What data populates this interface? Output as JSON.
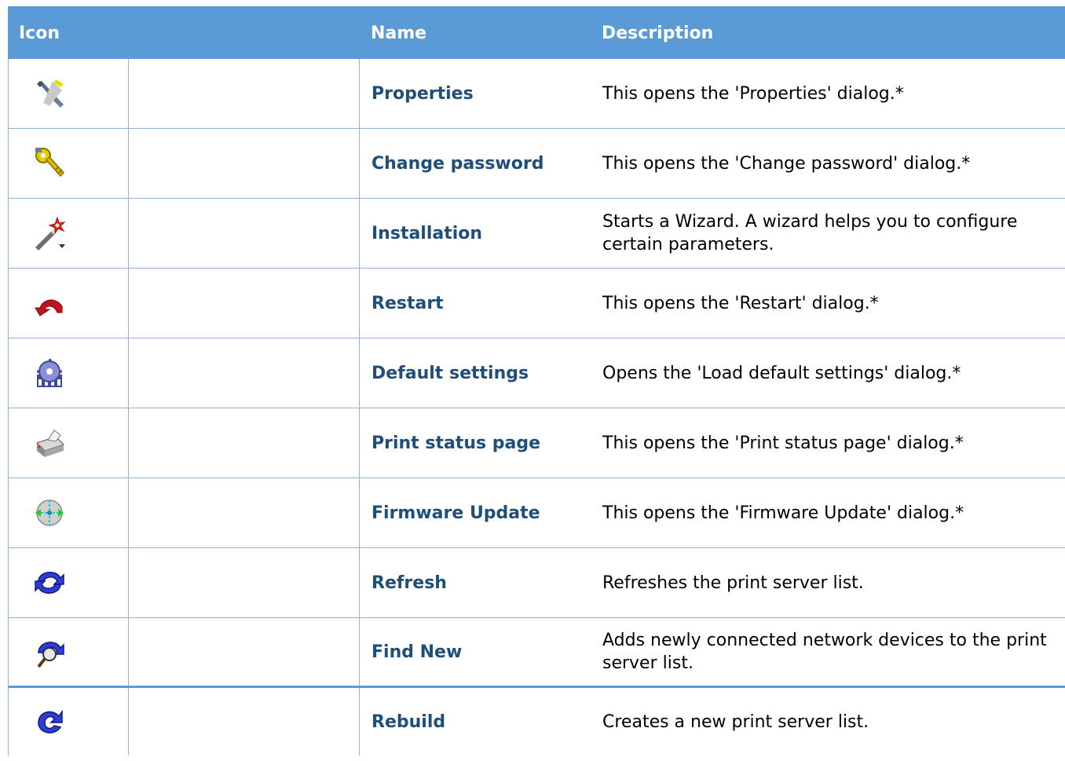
{
  "header": {
    "icon": "Icon",
    "name": "Name",
    "description": "Description"
  },
  "rows": [
    {
      "icon": "properties-tools-icon",
      "name": "Properties",
      "description": "This opens the 'Properties' dialog.*"
    },
    {
      "icon": "key-wrench-icon",
      "name": "Change password",
      "description": "This opens the 'Change password' dialog.*"
    },
    {
      "icon": "magic-wand-icon",
      "name": "Installation",
      "description": "Starts a Wizard. A wizard helps you to configure certain parameters."
    },
    {
      "icon": "restart-arrow-icon",
      "name": "Restart",
      "description": "This opens the 'Restart' dialog.*"
    },
    {
      "icon": "default-settings-gear-icon",
      "name": "Default settings",
      "description": "Opens the 'Load default settings' dialog.*"
    },
    {
      "icon": "printer-icon",
      "name": "Print status page",
      "description": "This opens the 'Print status page' dialog.*"
    },
    {
      "icon": "firmware-update-icon",
      "name": "Firmware Update",
      "description": "This opens the 'Firmware Update' dialog.*"
    },
    {
      "icon": "refresh-icon",
      "name": "Refresh",
      "description": "Refreshes the print server list."
    },
    {
      "icon": "find-new-icon",
      "name": "Find New",
      "description": "Adds newly connected network devices to the print server list."
    },
    {
      "icon": "rebuild-icon",
      "name": "Rebuild",
      "description": "Creates a new print server list."
    }
  ]
}
